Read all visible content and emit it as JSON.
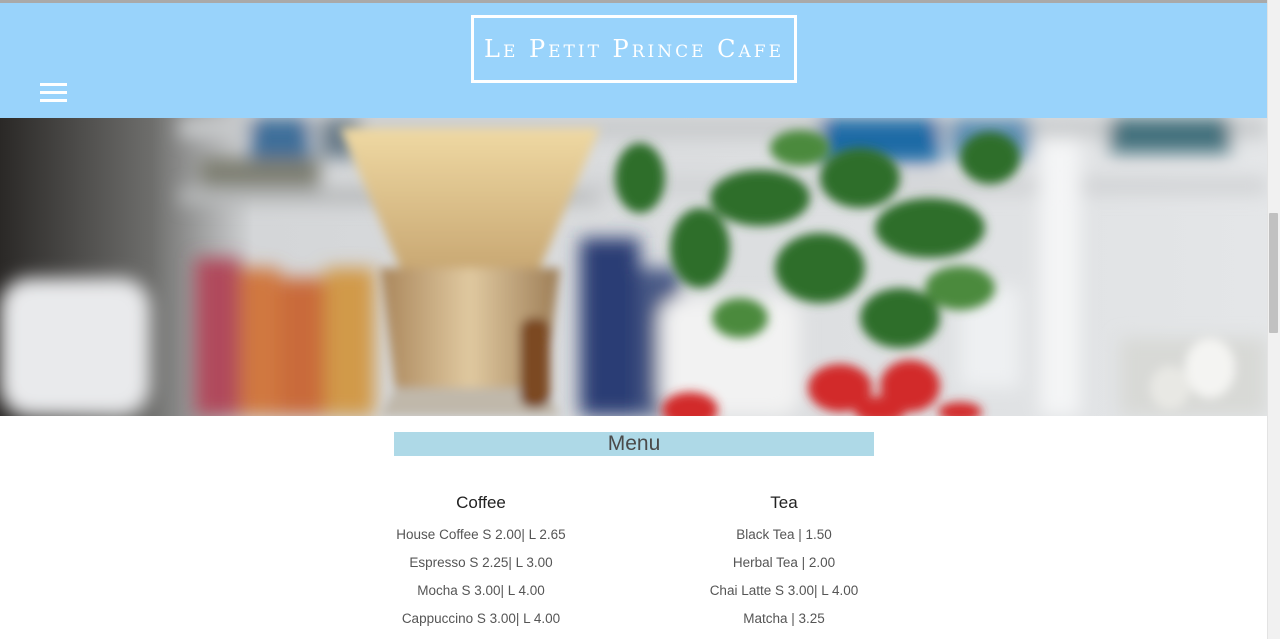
{
  "header": {
    "brand": "Le Petit Prince Cafe",
    "menu_icon": "hamburger-menu-icon",
    "background_color": "#99d3fb"
  },
  "hero": {
    "image": "blurred-cafe-photo-coffee-dripper-plant-strawberries"
  },
  "menu": {
    "title": "Menu",
    "title_background": "#aed9e7",
    "coffee": {
      "heading": "Coffee",
      "items": [
        "House Coffee S 2.00| L 2.65",
        "Espresso S 2.25| L 3.00",
        "Mocha S 3.00| L 4.00",
        "Cappuccino S 3.00| L 4.00"
      ]
    },
    "tea": {
      "heading": "Tea",
      "items": [
        "Black Tea | 1.50",
        "Herbal Tea | 2.00",
        "Chai Latte S 3.00| L 4.00",
        "Matcha | 3.25"
      ]
    }
  }
}
